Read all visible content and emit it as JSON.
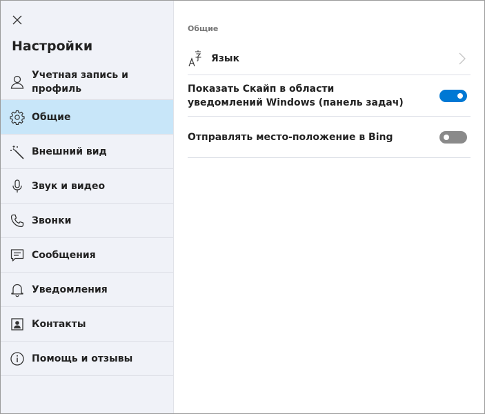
{
  "sidebar": {
    "title": "Настройки",
    "close_icon": "close-icon",
    "items": [
      {
        "label": "Учетная запись и профиль",
        "icon": "person-icon",
        "active": false
      },
      {
        "label": "Общие",
        "icon": "gear-icon",
        "active": true
      },
      {
        "label": "Внешний вид",
        "icon": "magic-wand-icon",
        "active": false
      },
      {
        "label": "Звук и видео",
        "icon": "microphone-icon",
        "active": false
      },
      {
        "label": "Звонки",
        "icon": "phone-icon",
        "active": false
      },
      {
        "label": "Сообщения",
        "icon": "message-icon",
        "active": false
      },
      {
        "label": "Уведомления",
        "icon": "bell-icon",
        "active": false
      },
      {
        "label": "Контакты",
        "icon": "contacts-icon",
        "active": false
      },
      {
        "label": "Помощь и отзывы",
        "icon": "info-icon",
        "active": false
      }
    ]
  },
  "main": {
    "section_title": "Общие",
    "language": {
      "label": "Язык",
      "icon": "language-icon"
    },
    "settings": [
      {
        "label": "Показать Скайп в области уведомлений Windows (панель задач)",
        "enabled": true
      },
      {
        "label": "Отправлять место-положение в Bing",
        "enabled": false
      }
    ]
  },
  "colors": {
    "accent": "#0078d4",
    "active_item_bg": "#c8e6f9",
    "sidebar_bg": "#f0f2f8",
    "toggle_off": "#8a8a8a"
  }
}
